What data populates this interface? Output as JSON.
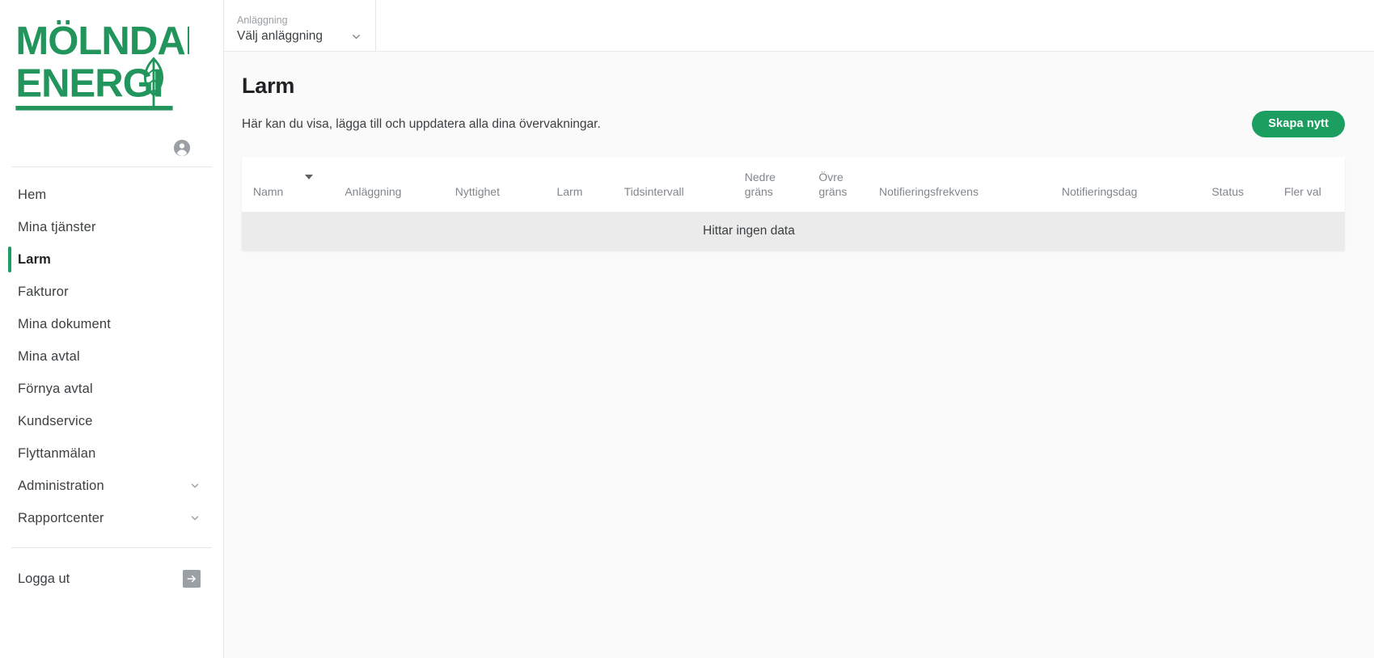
{
  "brand": {
    "name_line1": "MÖLNDAL",
    "name_line2": "ENERGI",
    "green": "#1d9e61"
  },
  "sidebar": {
    "account_icon": "account-circle-icon",
    "items": [
      {
        "label": "Hem",
        "active": false,
        "expandable": false
      },
      {
        "label": "Mina tjänster",
        "active": false,
        "expandable": false
      },
      {
        "label": "Larm",
        "active": true,
        "expandable": false
      },
      {
        "label": "Fakturor",
        "active": false,
        "expandable": false
      },
      {
        "label": "Mina dokument",
        "active": false,
        "expandable": false
      },
      {
        "label": "Mina avtal",
        "active": false,
        "expandable": false
      },
      {
        "label": "Förnya avtal",
        "active": false,
        "expandable": false
      },
      {
        "label": "Kundservice",
        "active": false,
        "expandable": false
      },
      {
        "label": "Flyttanmälan",
        "active": false,
        "expandable": false
      },
      {
        "label": "Administration",
        "active": false,
        "expandable": true
      },
      {
        "label": "Rapportcenter",
        "active": false,
        "expandable": true
      }
    ],
    "logout": {
      "label": "Logga ut",
      "icon": "logout-arrow-icon"
    }
  },
  "topbar": {
    "facility": {
      "label": "Anläggning",
      "value": "Välj anläggning",
      "chevron_icon": "chevron-down-icon"
    }
  },
  "main": {
    "title": "Larm",
    "subtitle": "Här kan du visa, lägga till och uppdatera alla dina övervakningar.",
    "create_button": "Skapa nytt"
  },
  "table": {
    "columns": [
      {
        "label": "Namn",
        "sorted": true,
        "sort_dir": "desc"
      },
      {
        "label": "Anläggning",
        "sorted": false
      },
      {
        "label": "Nyttighet",
        "sorted": false
      },
      {
        "label": "Larm",
        "sorted": false
      },
      {
        "label": "Tidsintervall",
        "sorted": false
      },
      {
        "label": "Nedre gräns",
        "sorted": false
      },
      {
        "label": "Övre gräns",
        "sorted": false
      },
      {
        "label": "Notifieringsfrekvens",
        "sorted": false
      },
      {
        "label": "Notifieringsdag",
        "sorted": false
      },
      {
        "label": "Status",
        "sorted": false
      },
      {
        "label": "Fler val",
        "sorted": false
      }
    ],
    "rows": [],
    "empty_message": "Hittar ingen data"
  }
}
